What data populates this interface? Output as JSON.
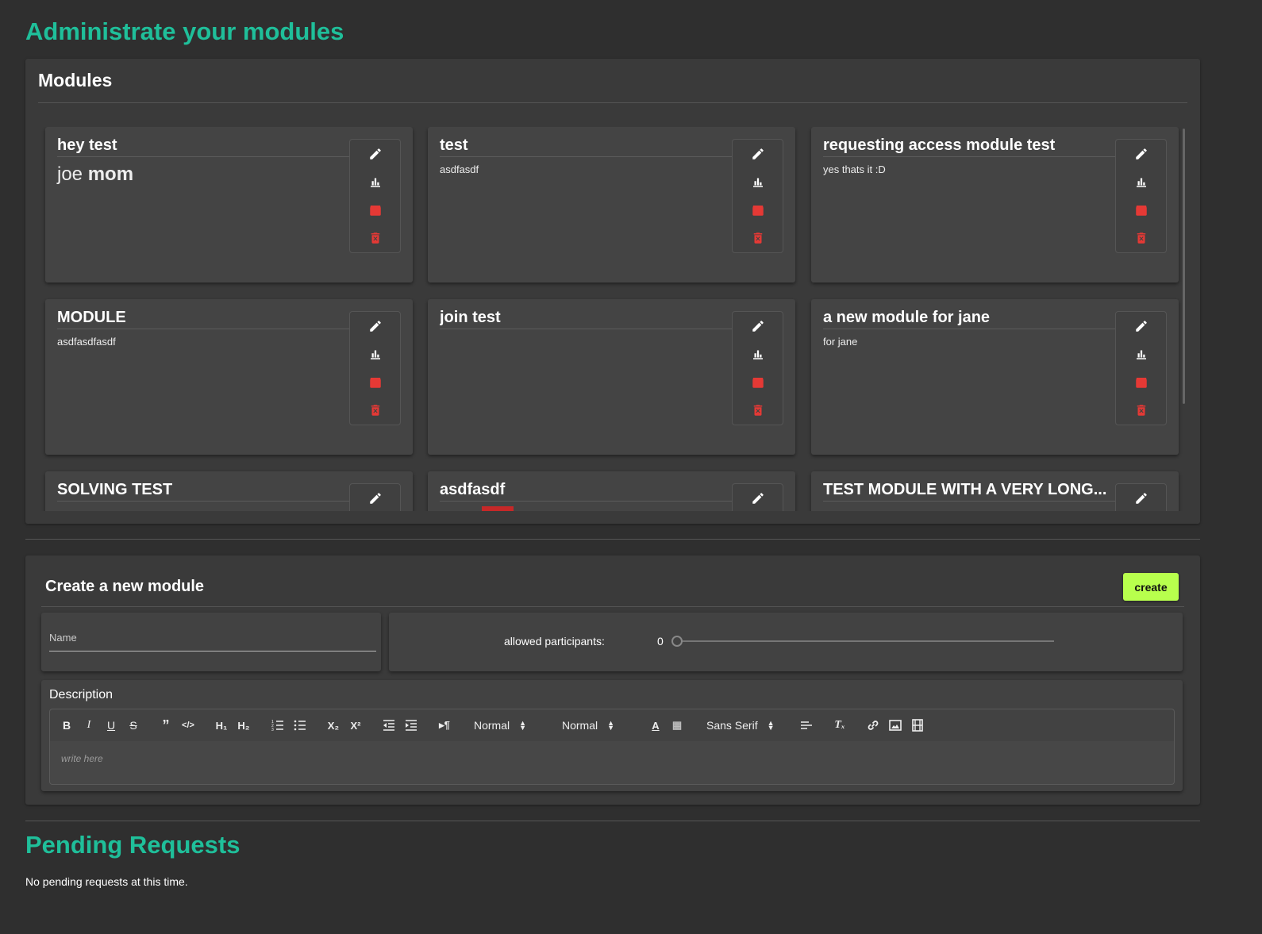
{
  "page": {
    "title": "Administrate your modules"
  },
  "modules_panel": {
    "title": "Modules",
    "modules": [
      {
        "title": "hey test",
        "desc_plain": "joe",
        "desc_bold": "mom"
      },
      {
        "title": "test",
        "desc": "asdfasdf"
      },
      {
        "title": "requesting access module test",
        "desc": "yes thats it :D"
      },
      {
        "title": "MODULE",
        "desc": "asdfasdfasdf"
      },
      {
        "title": "join test",
        "desc": ""
      },
      {
        "title": "a new module for jane",
        "desc": "for jane"
      },
      {
        "title": "SOLVING TEST",
        "desc": ""
      },
      {
        "title": "asdfasdf",
        "desc": ""
      },
      {
        "title": "TEST MODULE WITH A VERY LONG...",
        "desc": ""
      }
    ],
    "actions": {
      "edit_icon": "pencil-icon",
      "stats_icon": "bar-chart-icon",
      "archive_icon": "archive-icon",
      "delete_icon": "trash-icon",
      "danger_color": "#e53935"
    }
  },
  "create": {
    "title": "Create a new module",
    "button_label": "create",
    "name_label": "Name",
    "participants_label": "allowed participants:",
    "participants_value": "0",
    "description_label": "Description",
    "editor_placeholder": "write here",
    "toolbar": {
      "header_select": "Normal",
      "size_select": "Normal",
      "font_select": "Sans Serif"
    },
    "button_color": "#b8ff4d"
  },
  "pending": {
    "title": "Pending Requests",
    "message": "No pending requests at this time."
  },
  "colors": {
    "accent": "#1fbf9a",
    "background": "#2f2f2f",
    "panel": "#3a3a3a",
    "card": "#444444"
  }
}
